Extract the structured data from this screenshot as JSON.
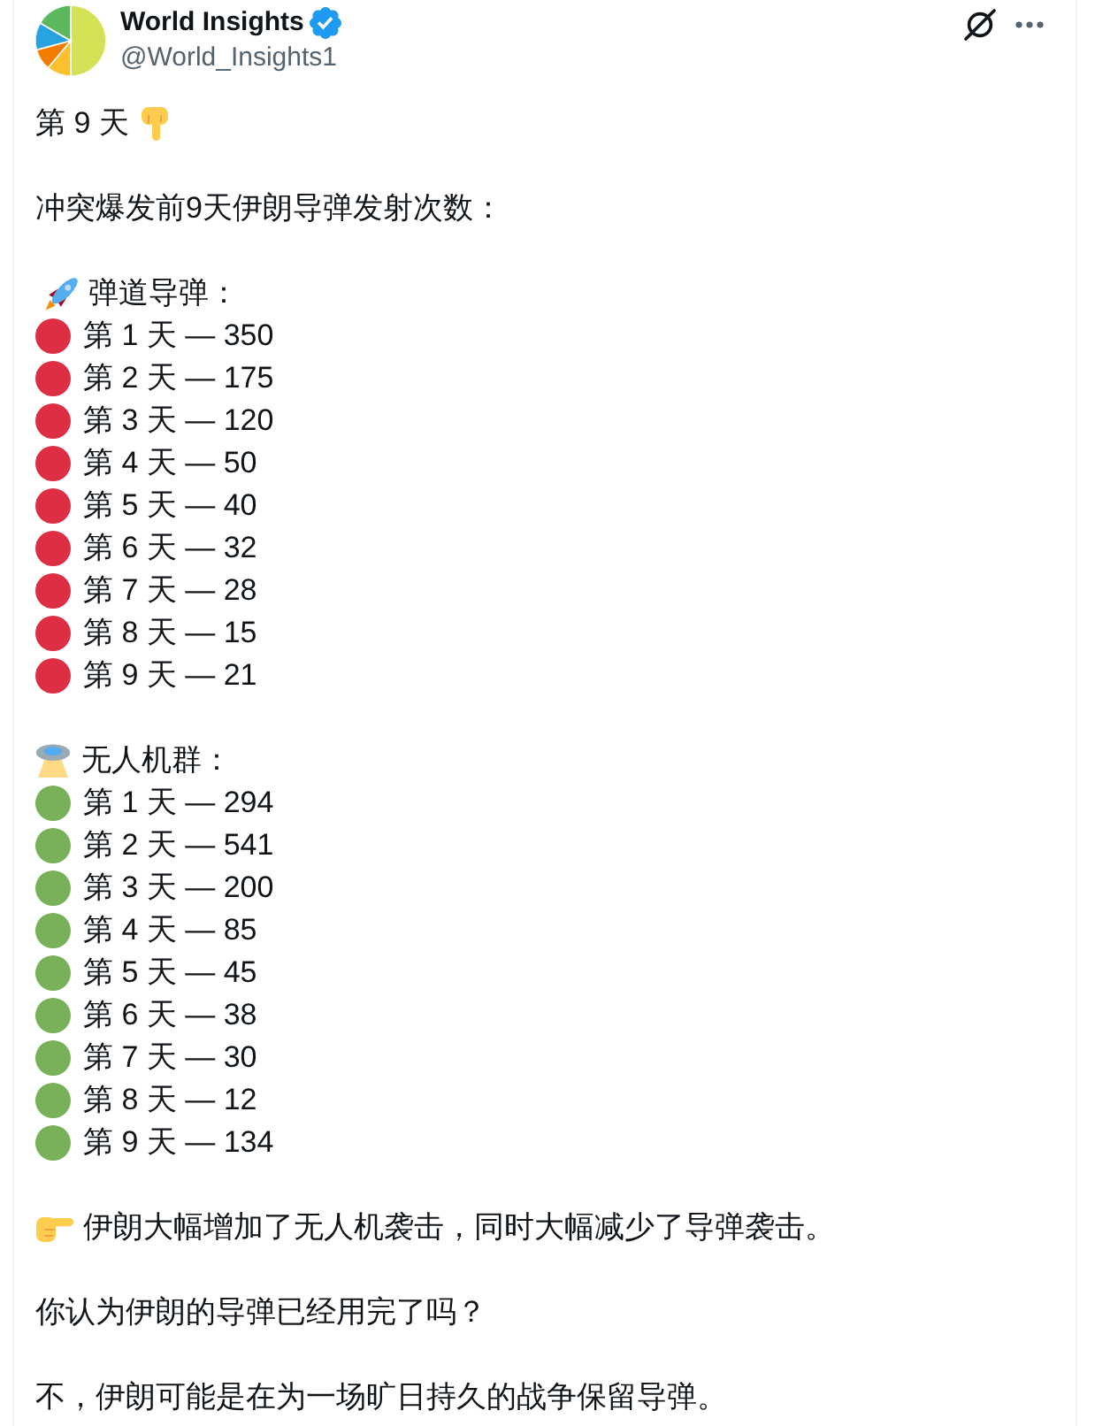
{
  "author": {
    "name": "World Insights",
    "verified": true,
    "handle": "@World_Insights1"
  },
  "post": {
    "title": "第 9 天",
    "intro": "冲突爆发前9天伊朗导弹发射次数：",
    "sections": [
      {
        "kind": "missiles",
        "heading": "弹道导弹：",
        "color": "#dd2e44",
        "items": [
          "第 1 天 — 350",
          "第 2 天 — 175",
          "第 3 天 — 120",
          "第 4 天 — 50",
          "第 5 天 — 40",
          "第 6 天 — 32",
          "第 7 天 — 28",
          "第 8 天 — 15",
          "第 9 天 — 21"
        ]
      },
      {
        "kind": "drones",
        "heading": "无人机群：",
        "color": "#78b159",
        "items": [
          "第 1 天 — 294",
          "第 2 天 — 541",
          "第 3 天 — 200",
          "第 4 天 — 85",
          "第 5 天 — 45",
          "第 6 天 — 38",
          "第 7 天 — 30",
          "第 8 天 — 12",
          "第 9 天 — 134"
        ]
      }
    ],
    "observation": "伊朗大幅增加了无人机袭击，同时大幅减少了导弹袭击。",
    "question": "你认为伊朗的导弹已经用完了吗？",
    "answer": "不，伊朗可能是在为一场旷日持久的战争保留导弹。"
  }
}
